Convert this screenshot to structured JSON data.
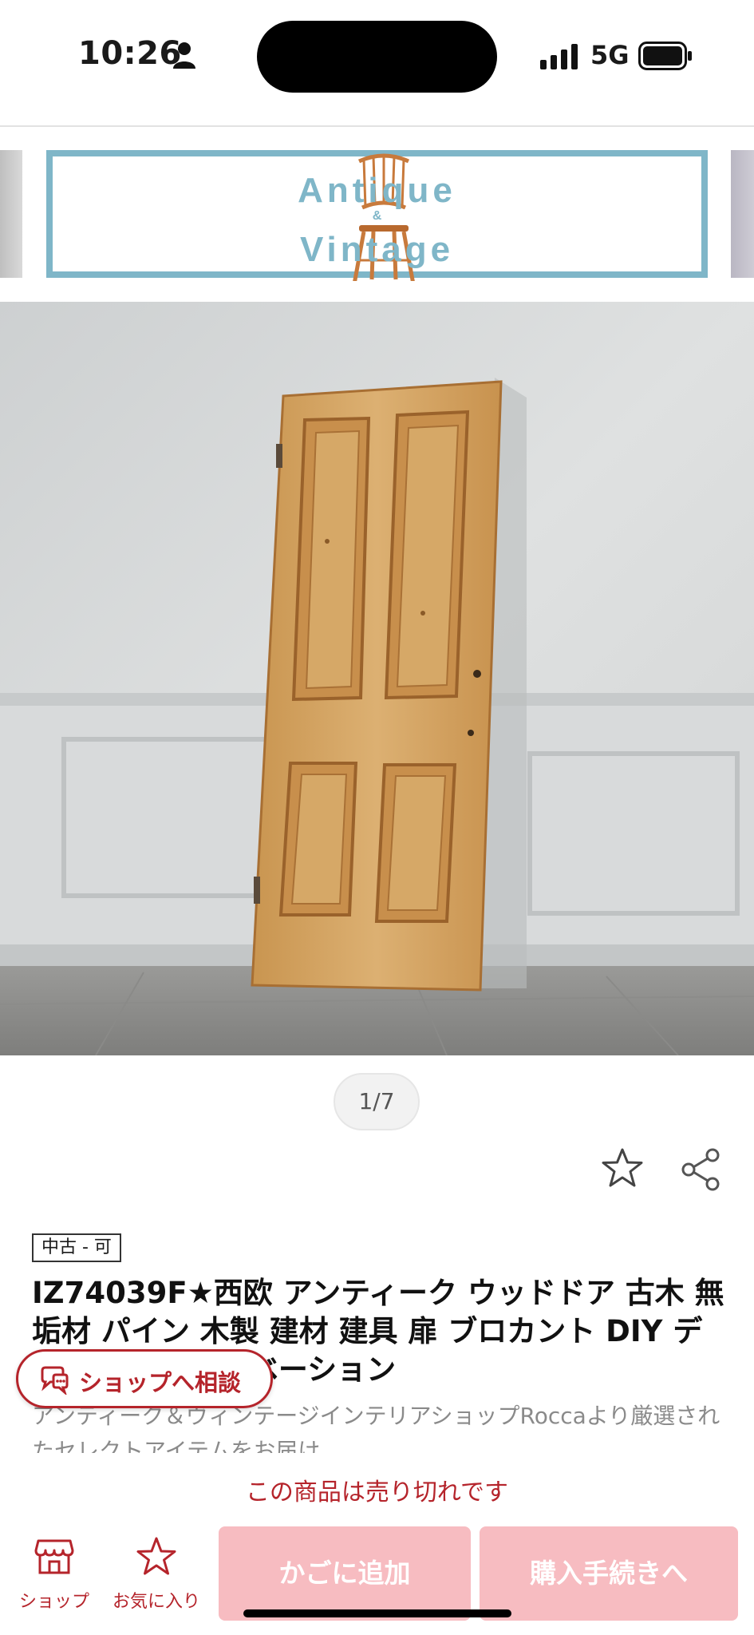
{
  "status_bar": {
    "time": "10:26",
    "network": "5G",
    "icons": [
      "person-icon",
      "signal-icon",
      "battery-icon"
    ]
  },
  "banner": {
    "line1": "Antique",
    "amp": "&",
    "line2": "Vintage",
    "color": "#7fb6c8"
  },
  "gallery": {
    "counter": "1/7"
  },
  "product": {
    "condition": "中古 - 可",
    "title": "IZ74039F★西欧 アンティーク ウッドドア 古木 無垢材 パイン 木製 建材 建具 扉 ブロカント DIY ディスプレイ リノベーション",
    "description": "アンティーク＆ヴィンテージインテリアショップRoccaより厳選されたセレクトアイテムをお届け",
    "soldout_notice": "この商品は売り切れです"
  },
  "actions": {
    "consult_label": "ショップへ相談",
    "shop_label": "ショップ",
    "favorite_label": "お気に入り",
    "cart_label": "かごに追加",
    "checkout_label": "購入手続きへ"
  },
  "colors": {
    "accent": "#b5242b",
    "disabled_button": "#f7bcc1",
    "banner_frame": "#7fb6c8"
  }
}
